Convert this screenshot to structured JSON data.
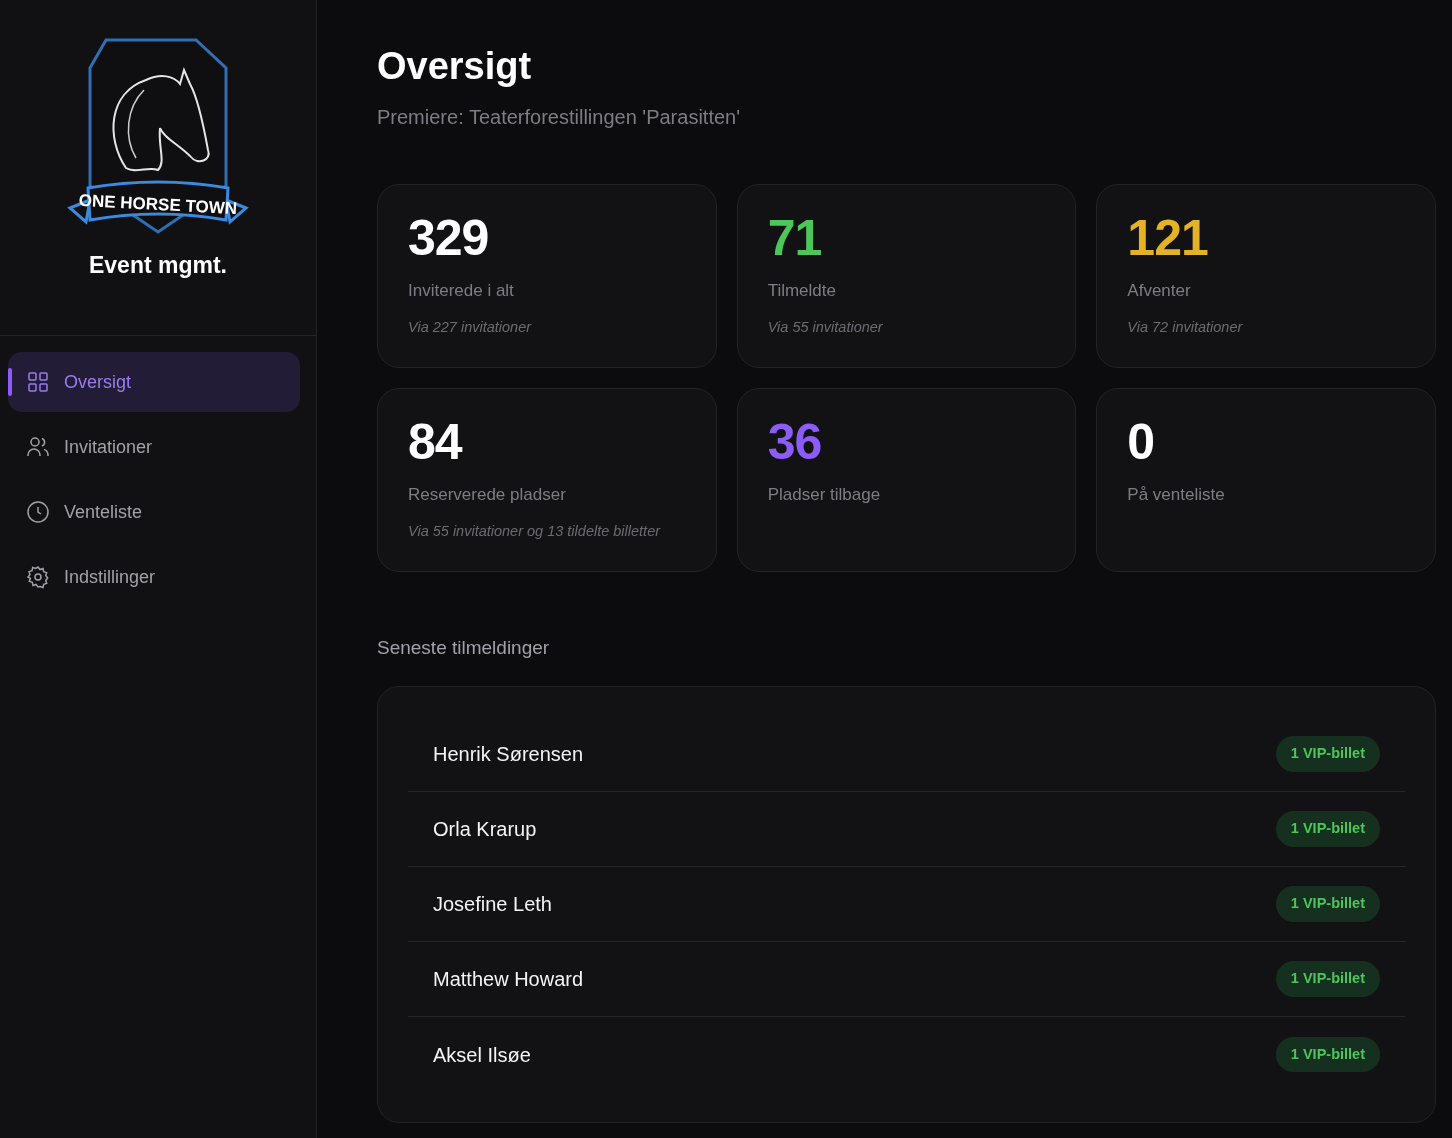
{
  "sidebar": {
    "logo_text": "ONE HORSE TOWN",
    "brand": "Event mgmt.",
    "items": [
      {
        "label": "Oversigt",
        "selected": true
      },
      {
        "label": "Invitationer",
        "selected": false
      },
      {
        "label": "Venteliste",
        "selected": false
      },
      {
        "label": "Indstillinger",
        "selected": false
      }
    ]
  },
  "header": {
    "title": "Oversigt",
    "subtitle": "Premiere: Teaterforestillingen 'Parasitten'"
  },
  "stats": [
    {
      "value": "329",
      "label": "Inviterede i alt",
      "note": "Via 227 invitationer",
      "color": "#ffffff"
    },
    {
      "value": "71",
      "label": "Tilmeldte",
      "note": "Via 55 invitationer",
      "color": "#4cc65a"
    },
    {
      "value": "121",
      "label": "Afventer",
      "note": "Via 72 invitationer",
      "color": "#e3b226"
    },
    {
      "value": "84",
      "label": "Reserverede pladser",
      "note": "Via 55 invitationer og 13 tildelte billetter",
      "color": "#ffffff"
    },
    {
      "value": "36",
      "label": "Pladser tilbage",
      "color": "#8b5cf6"
    },
    {
      "value": "0",
      "label": "På venteliste",
      "color": "#ffffff"
    }
  ],
  "recent": {
    "title": "Seneste tilmeldinger",
    "rows": [
      {
        "name": "Henrik Sørensen",
        "badge": "1 VIP-billet"
      },
      {
        "name": "Orla Krarup",
        "badge": "1 VIP-billet"
      },
      {
        "name": "Josefine Leth",
        "badge": "1 VIP-billet"
      },
      {
        "name": "Matthew Howard",
        "badge": "1 VIP-billet"
      },
      {
        "name": "Aksel Ilsøe",
        "badge": "1 VIP-billet"
      }
    ]
  }
}
